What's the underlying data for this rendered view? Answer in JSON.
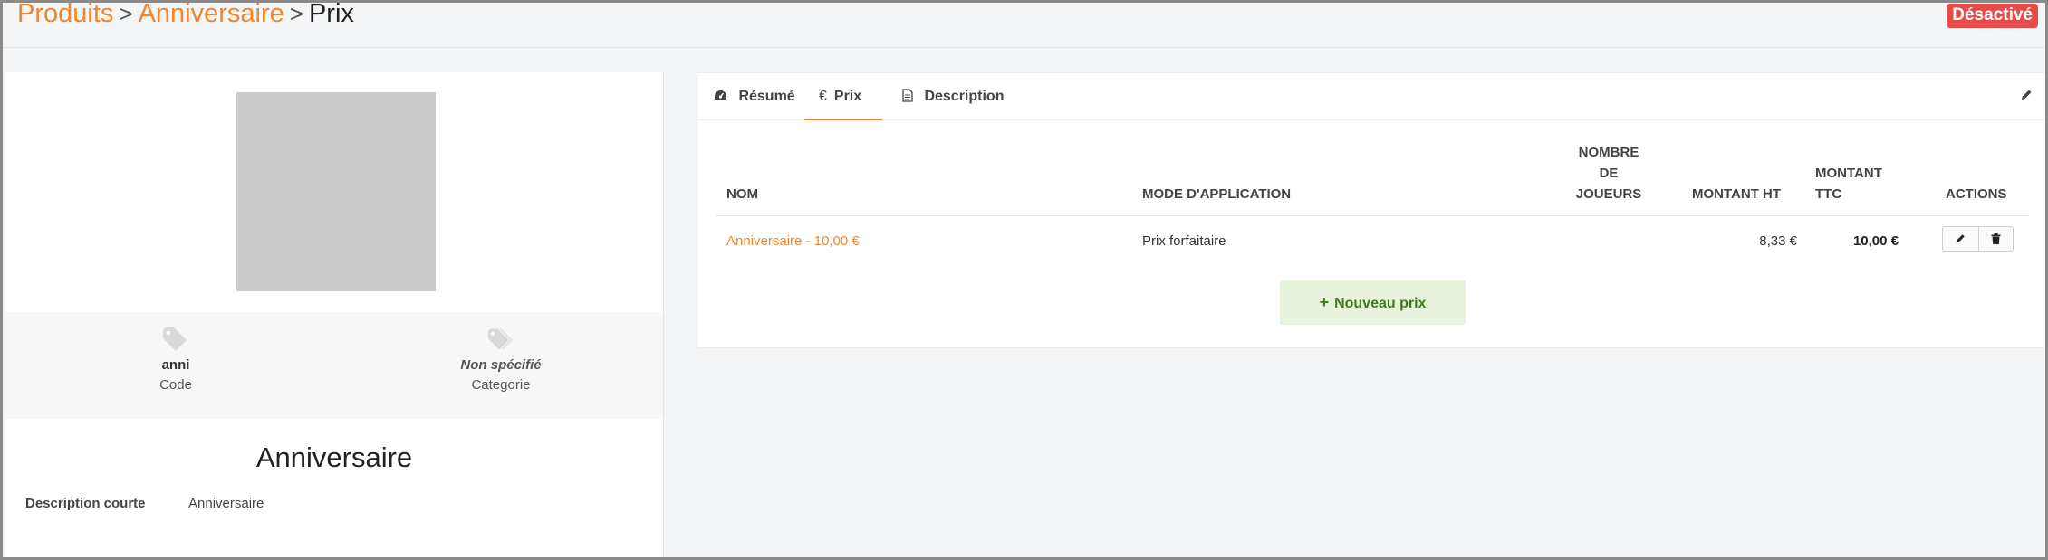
{
  "header": {
    "breadcrumb": [
      {
        "label": "Produits"
      },
      {
        "label": "Anniversaire"
      },
      {
        "label": "Prix"
      }
    ],
    "separator": ">",
    "status": "Désactivé"
  },
  "product": {
    "image_placeholder": true,
    "code_value": "anni",
    "code_label": "Code",
    "category_value": "Non spécifié",
    "category_label": "Categorie",
    "title": "Anniversaire",
    "short_desc_label": "Description courte",
    "short_desc_value": "Anniversaire"
  },
  "tabs": [
    {
      "label": "Résumé",
      "icon": "dashboard-icon"
    },
    {
      "label": "Prix",
      "icon": "euro-icon",
      "active": true
    },
    {
      "label": "Description",
      "icon": "document-icon"
    }
  ],
  "icons": {
    "euro_glyph": "€",
    "plus_glyph": "+"
  },
  "table": {
    "headers": {
      "nom": "NOM",
      "mode": "MODE D'APPLICATION",
      "nb_line1": "NOMBRE",
      "nb_line2": "DE",
      "nb_line3": "JOUEURS",
      "ht": "MONTANT HT",
      "ttc_line1": "MONTANT",
      "ttc_line2": "TTC",
      "actions": "ACTIONS"
    },
    "rows": [
      {
        "nom": "Anniversaire - 10,00 €",
        "mode": "Prix forfaitaire",
        "joueurs": "",
        "ht": "8,33 €",
        "ttc": "10,00 €"
      }
    ]
  },
  "new_price_label": "Nouveau prix",
  "colors": {
    "accent": "#f0852d",
    "danger": "#e84a4a",
    "success_bg": "#e7f3dc",
    "success_text": "#3f7a1f"
  }
}
